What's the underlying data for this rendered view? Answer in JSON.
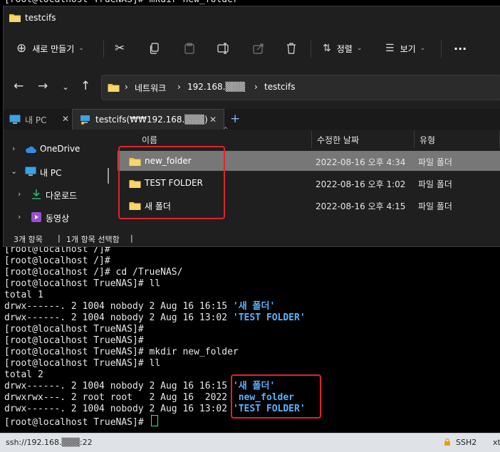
{
  "terminal": {
    "top_line": "[root@localhost TrueNAS]# mkdir new_folder",
    "lines": [
      {
        "text": "[root@localhost /]#"
      },
      {
        "text": "[root@localhost /]#"
      },
      {
        "text": "[root@localhost /]# cd /TrueNAS/"
      },
      {
        "text": "[root@localhost TrueNAS]# ll"
      },
      {
        "text": "total 1"
      },
      {
        "text": "drwx------. 2 1004 nobody 2 Aug 16 16:15 ",
        "blue": "'새 폴더'"
      },
      {
        "text": "drwx------. 2 1004 nobody 2 Aug 16 13:02 ",
        "blue": "'TEST FOLDER'"
      },
      {
        "text": "[root@localhost TrueNAS]#"
      },
      {
        "text": "[root@localhost TrueNAS]#"
      },
      {
        "text": "[root@localhost TrueNAS]# mkdir new_folder"
      },
      {
        "text": "[root@localhost TrueNAS]# ll"
      },
      {
        "text": "total 2"
      },
      {
        "text": "drwx------. 2 1004 nobody 2 Aug 16 16:15 ",
        "blue": "'새 폴더'"
      },
      {
        "text": "drwxrwx---. 2 root root   2 Aug 16  2022 ",
        "blue": " new_folder"
      },
      {
        "text": "drwx------. 2 1004 nobody 2 Aug 16 13:02 ",
        "blue": "'TEST FOLDER'"
      },
      {
        "text": "[root@localhost TrueNAS]# "
      }
    ]
  },
  "statusbar": {
    "connection": "ssh://192.168.▒▒▒:22",
    "protocol": "SSH2",
    "extra": "xt"
  },
  "explorer": {
    "title": "testcifs",
    "toolbar": {
      "new_label": "새로 만들기",
      "sort_label": "정렬",
      "view_label": "보기",
      "more_label": "···"
    },
    "address": {
      "network": "네트워크",
      "ip": "192.168.▒▒▒",
      "share": "testcifs",
      "sep": "›"
    },
    "tabs": [
      {
        "label": "내 PC"
      },
      {
        "label": "testcifs(₩₩192.168.▒▒▒)"
      }
    ],
    "nav": [
      {
        "label": "OneDrive"
      },
      {
        "label": "내 PC"
      },
      {
        "label": "다운로드"
      },
      {
        "label": "동영상"
      }
    ],
    "columns": [
      "이름",
      "수정한 날짜",
      "유형"
    ],
    "files": [
      {
        "name": "new_folder",
        "date": "2022-08-16 오후 4:34",
        "type": "파일 폴더",
        "selected": true
      },
      {
        "name": "TEST FOLDER",
        "date": "2022-08-16 오후 1:02",
        "type": "파일 폴더",
        "selected": false
      },
      {
        "name": "새 폴더",
        "date": "2022-08-16 오후 4:15",
        "type": "파일 폴더",
        "selected": false
      }
    ],
    "footer": {
      "count": "3개 항목",
      "selected": "1개 항목 선택함",
      "sep1": "|",
      "sep2": "|"
    }
  },
  "colors": {
    "terminal_bg": "#000000",
    "terminal_text": "#e8e8e8",
    "dir_blue": "#5ab2ff",
    "highlight_red": "#e0242a",
    "explorer_bg": "#1f1f1f",
    "folder_yellow": "#f4c542"
  }
}
